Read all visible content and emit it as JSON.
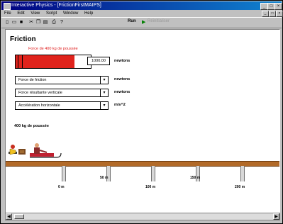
{
  "window": {
    "title": "Interactive Physics - [FrictionFirstMAIPS]"
  },
  "menu": [
    "File",
    "Edit",
    "View",
    "Script",
    "Window",
    "Help"
  ],
  "toolbar": {
    "run_label": "Run",
    "pause_label": "Réinitialiser"
  },
  "page": {
    "title": "Friction",
    "force_label": "Force de 400 kg de poussée",
    "force_value": "1000.00",
    "force_fraction": 0.78,
    "force_unit": "newtons",
    "selects": [
      {
        "value": "Force de friction",
        "unit": "newtons"
      },
      {
        "value": "Force résultante verticale",
        "unit": "newtons"
      },
      {
        "value": "Accélération horizontale",
        "unit": "m/s^2"
      }
    ],
    "sled_label": "400 kg de poussée",
    "distances": [
      "0 m",
      "50 m",
      "100 m",
      "150 m",
      "200 m"
    ]
  },
  "colors": {
    "force_bar": "#e0231c",
    "ground": "#b26a28",
    "titlebar": "#000080"
  }
}
